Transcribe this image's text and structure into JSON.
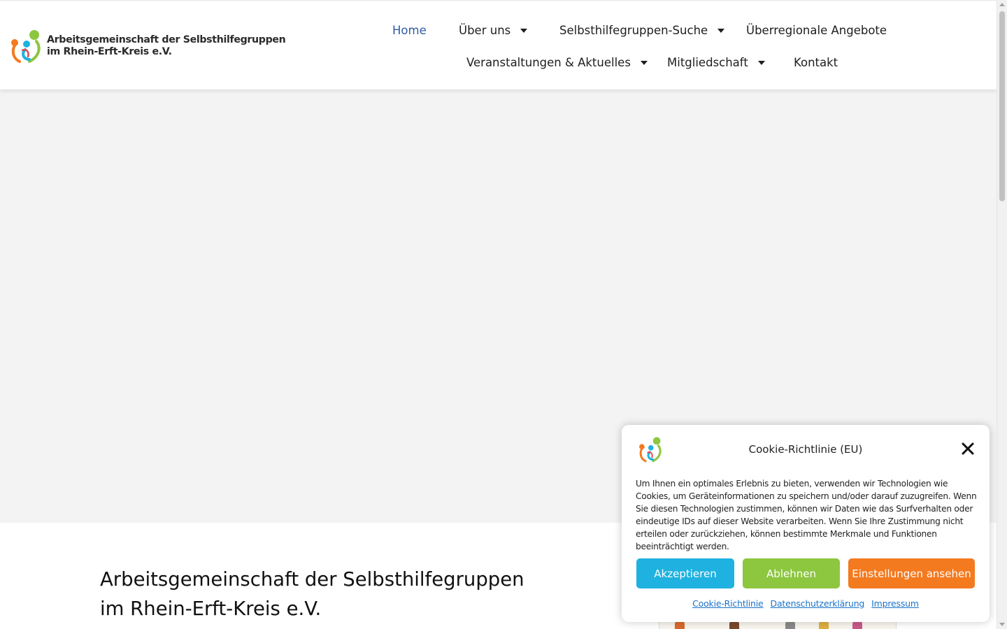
{
  "header": {
    "logo_line1": "Arbeitsgemeinschaft der Selbsthilfegruppen",
    "logo_line2": "im Rhein-Erft-Kreis e.V."
  },
  "nav": {
    "items": [
      {
        "label": "Home",
        "active": true,
        "has_dropdown": false
      },
      {
        "label": "Über uns",
        "has_dropdown": true
      },
      {
        "label": "Selbsthilfegruppen-Suche",
        "has_dropdown": true
      },
      {
        "label": "Überregionale Angebote",
        "has_dropdown": false
      },
      {
        "label": "Veranstaltungen & Aktuelles",
        "has_dropdown": true
      },
      {
        "label": "Mitgliedschaft",
        "has_dropdown": true
      },
      {
        "label": "Kontakt",
        "has_dropdown": false
      }
    ]
  },
  "content": {
    "title_line1": "Arbeitsgemeinschaft der Selbsthilfegruppen",
    "title_line2": "im Rhein-Erft-Kreis e.V."
  },
  "cookie": {
    "title": "Cookie-Richtlinie (EU)",
    "text": "Um Ihnen ein optimales Erlebnis zu bieten, verwenden wir Technologien wie Cookies, um Geräteinformationen zu speichern und/oder darauf zuzugreifen. Wenn Sie diesen Technologien zustimmen, können wir Daten wie das Surfverhalten oder eindeutige IDs auf dieser Website verarbeiten. Wenn Sie Ihre Zustimmung nicht erteilen oder zurückziehen, können bestimmte Merkmale und Funktionen beeinträchtigt werden.",
    "accept_label": "Akzeptieren",
    "deny_label": "Ablehnen",
    "settings_label": "Einstellungen ansehen",
    "links": [
      "Cookie-Richtlinie",
      "Datenschutzerklärung",
      "Impressum"
    ]
  },
  "colors": {
    "nav_active": "#2f5aa8",
    "accept": "#1fb2e0",
    "deny": "#8dc63f",
    "settings": "#f47a20",
    "link": "#1a73c9",
    "logo_orange": "#f47a20",
    "logo_green": "#8dc63f",
    "logo_blue": "#1fb2e0"
  },
  "icons": {
    "logo": "people-logo-icon",
    "close": "close-icon",
    "dropdown": "caret-down-icon"
  }
}
